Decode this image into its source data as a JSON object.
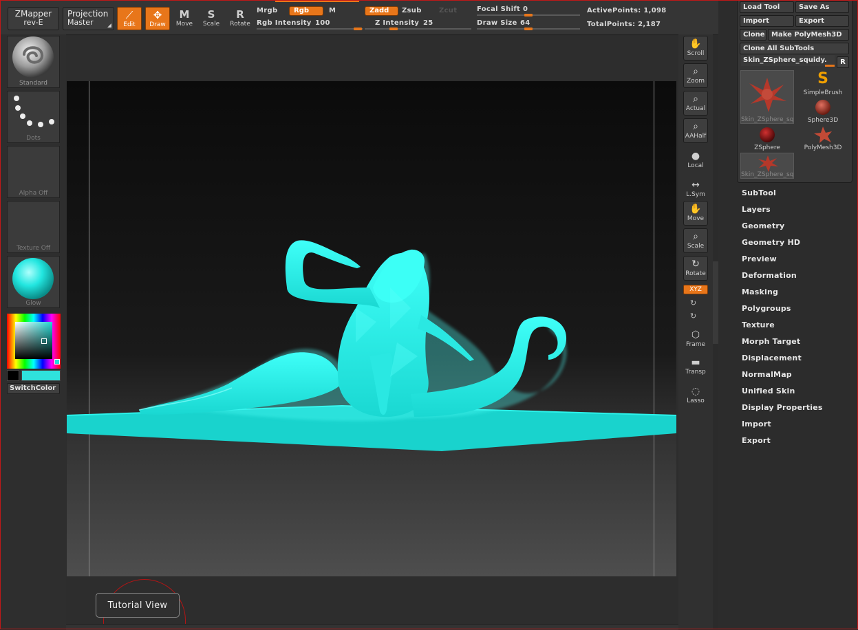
{
  "topbar": {
    "zmapper": {
      "line1": "ZMapper",
      "line2": "rev-E"
    },
    "projection": {
      "line1": "Projection",
      "line2": "Master"
    },
    "tools": [
      {
        "label": "Edit",
        "glyph": "⟋",
        "active": true
      },
      {
        "label": "Draw",
        "glyph": "✥",
        "active": true
      },
      {
        "label": "Move",
        "glyph": "M",
        "active": false
      },
      {
        "label": "Scale",
        "glyph": "S",
        "active": false
      },
      {
        "label": "Rotate",
        "glyph": "R",
        "active": false
      }
    ],
    "mrgb": "Mrgb",
    "rgb": "Rgb",
    "m": "M",
    "rgb_intensity_label": "Rgb Intensity",
    "rgb_intensity": "100",
    "zadd": "Zadd",
    "zsub": "Zsub",
    "zcut": "Zcut",
    "z_intensity_label": "Z Intensity",
    "z_intensity": "25",
    "focal_shift_label": "Focal Shift",
    "focal_shift": "0",
    "draw_size_label": "Draw Size",
    "draw_size": "64",
    "active_points": "ActivePoints: 1,098",
    "total_points": "TotalPoints: 2,187"
  },
  "left_shelf": {
    "brush": "Standard",
    "stroke": "Dots",
    "alpha": "Alpha Off",
    "texture": "Texture Off",
    "material": "Glow",
    "switch_color": "SwitchColor"
  },
  "canvas": {
    "tutorial_view": "Tutorial View"
  },
  "right_shelf": [
    {
      "label": "Scroll",
      "glyph": "✋"
    },
    {
      "label": "Zoom",
      "glyph": "⌕"
    },
    {
      "label": "Actual",
      "glyph": "⌕"
    },
    {
      "label": "AAHalf",
      "glyph": "⌕"
    },
    {
      "label": "Local",
      "glyph": "●"
    },
    {
      "label": "L.Sym",
      "glyph": "↔"
    },
    {
      "label": "Move",
      "glyph": "✋"
    },
    {
      "label": "Scale",
      "glyph": "⌕"
    },
    {
      "label": "Rotate",
      "glyph": "↻"
    }
  ],
  "right_shelf_extra": {
    "xyz": "XYZ",
    "frame": "Frame",
    "transp": "Transp",
    "lasso": "Lasso"
  },
  "tool_palette": {
    "load_tool": "Load Tool",
    "save_as": "Save As",
    "import": "Import",
    "export": "Export",
    "clone": "Clone",
    "make_polymesh": "Make PolyMesh3D",
    "clone_all": "Clone All SubTools",
    "current_tool": "Skin_ZSphere_squidy.",
    "r_button": "R",
    "thumbs": [
      {
        "name": "Skin_ZSphere_squidy",
        "kind": "creature",
        "selected": true
      },
      {
        "name": "SimpleBrush",
        "kind": "simplebrush",
        "selected": false
      },
      {
        "name": "Sphere3D",
        "kind": "sphere",
        "selected": false
      },
      {
        "name": "ZSphere",
        "kind": "zsphere",
        "selected": false
      },
      {
        "name": "PolyMesh3D",
        "kind": "star",
        "selected": false
      },
      {
        "name": "Skin_ZSphere_squidy",
        "kind": "creature-small",
        "selected": true
      }
    ],
    "menu": [
      "SubTool",
      "Layers",
      "Geometry",
      "Geometry HD",
      "Preview",
      "Deformation",
      "Masking",
      "Polygroups",
      "Texture",
      "Morph Target",
      "Displacement",
      "NormalMap",
      "Unified Skin",
      "Display Properties",
      "Import",
      "Export"
    ]
  },
  "colors": {
    "accent": "#e8761a",
    "model": "#22f0ea",
    "frame": "#c01818"
  }
}
